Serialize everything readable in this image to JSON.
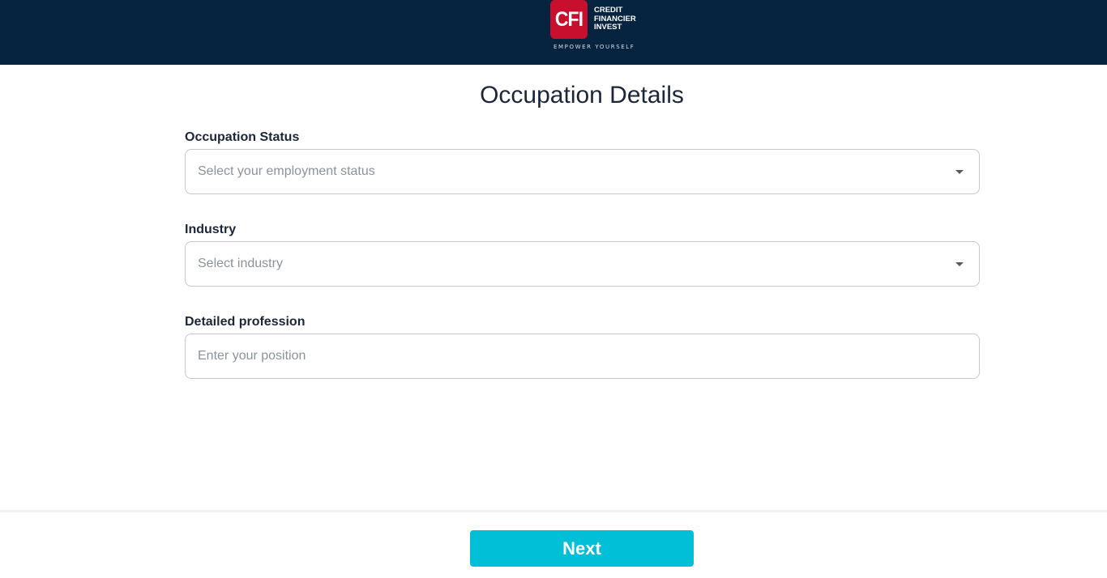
{
  "header": {
    "logo_mark": "CFI",
    "logo_lines": [
      "CREDIT",
      "FINANCIER",
      "INVEST"
    ],
    "tagline": "EMPOWER YOURSELF",
    "background_color": "#062440",
    "logo_color": "#c8102e"
  },
  "page": {
    "title": "Occupation Details"
  },
  "form": {
    "occupation_status": {
      "label": "Occupation Status",
      "placeholder": "Select your employment status"
    },
    "industry": {
      "label": "Industry",
      "placeholder": "Select industry"
    },
    "profession": {
      "label": "Detailed profession",
      "placeholder": "Enter your position"
    }
  },
  "footer": {
    "next_label": "Next",
    "button_color": "#00bfd6"
  },
  "icons": {
    "dropdown": "chevron-down-icon"
  }
}
